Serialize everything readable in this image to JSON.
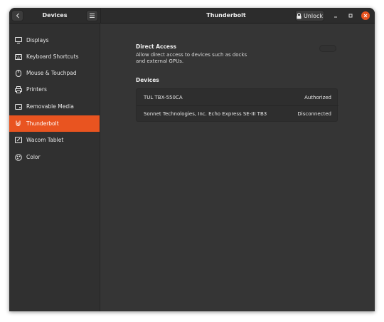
{
  "titlebar": {
    "sidebar_title": "Devices",
    "window_title": "Thunderbolt",
    "unlock_label": "Unlock"
  },
  "sidebar": {
    "items": [
      {
        "label": "Displays",
        "icon": "display-icon",
        "active": false
      },
      {
        "label": "Keyboard Shortcuts",
        "icon": "keyboard-icon",
        "active": false
      },
      {
        "label": "Mouse & Touchpad",
        "icon": "mouse-icon",
        "active": false
      },
      {
        "label": "Printers",
        "icon": "printer-icon",
        "active": false
      },
      {
        "label": "Removable Media",
        "icon": "media-icon",
        "active": false
      },
      {
        "label": "Thunderbolt",
        "icon": "thunderbolt-icon",
        "active": true
      },
      {
        "label": "Wacom Tablet",
        "icon": "tablet-icon",
        "active": false
      },
      {
        "label": "Color",
        "icon": "color-icon",
        "active": false
      }
    ]
  },
  "main": {
    "direct_access": {
      "title": "Direct Access",
      "description": "Allow direct access to devices such as docks and external GPUs.",
      "enabled": false
    },
    "devices_title": "Devices",
    "devices": [
      {
        "name": "TUL TBX-550CA",
        "status": "Authorized"
      },
      {
        "name": "Sonnet Technologies, Inc. Echo Express SE-III TB3",
        "status": "Disconnected"
      }
    ]
  },
  "colors": {
    "accent": "#e95420",
    "background": "#353535",
    "sidebar": "#303030",
    "titlebar": "#2c2c2c"
  }
}
